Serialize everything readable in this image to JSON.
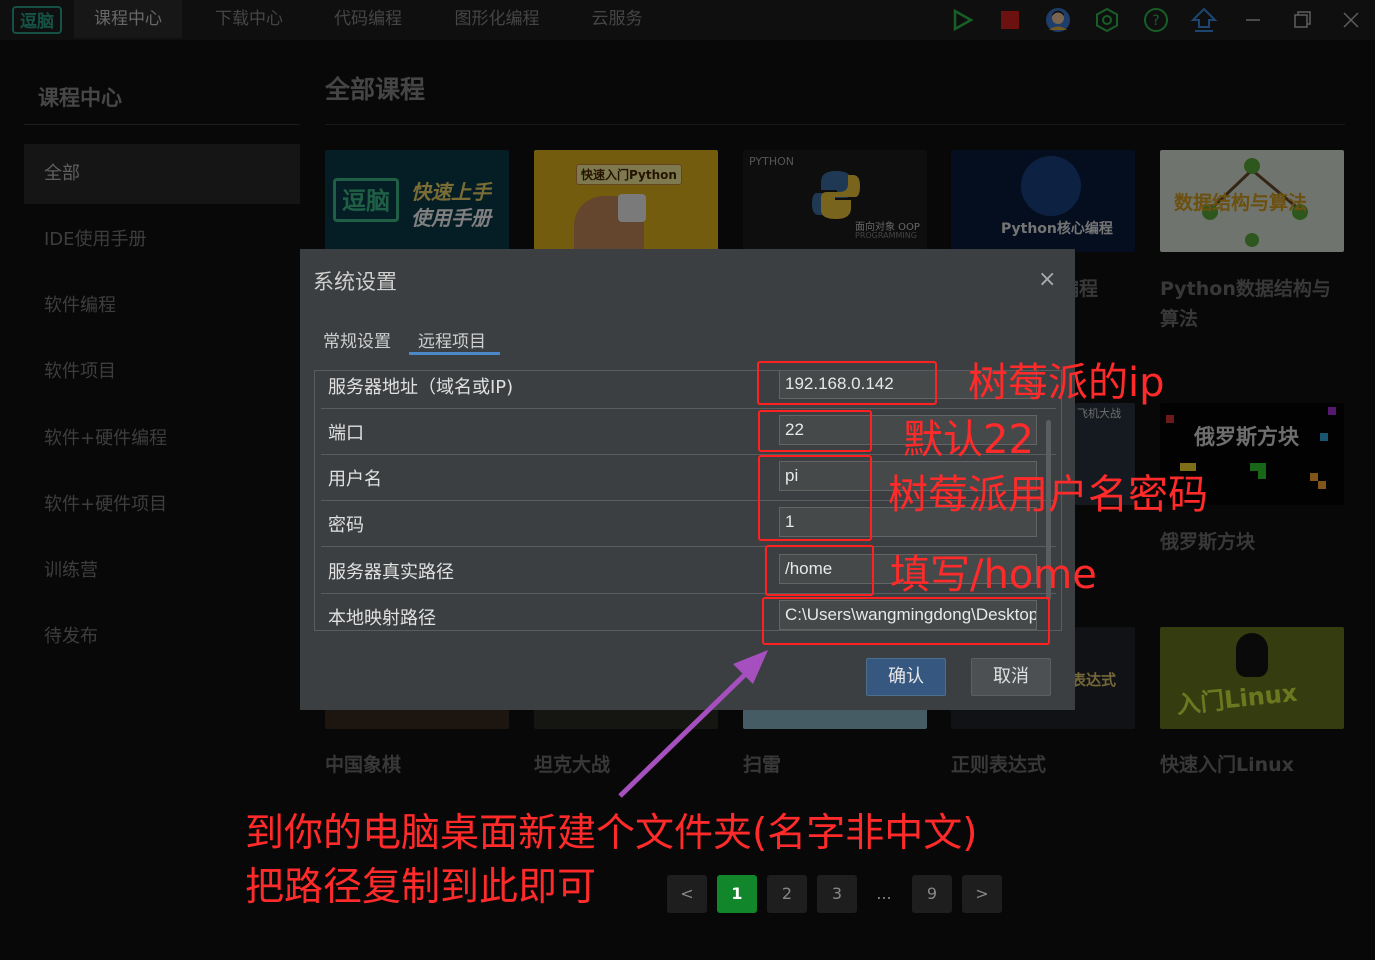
{
  "app": {
    "logo_text": "逗脑"
  },
  "nav": {
    "tabs": [
      "课程中心",
      "下载中心",
      "代码编程",
      "图形化编程",
      "云服务"
    ],
    "active_index": 0
  },
  "toolbar_icons": [
    "run-icon",
    "stop-icon",
    "user-avatar-icon",
    "settings-hex-icon",
    "help-icon",
    "upload-icon",
    "minimize-icon",
    "restore-icon",
    "close-icon"
  ],
  "sidebar": {
    "title": "课程中心",
    "items": [
      "全部",
      "IDE使用手册",
      "软件编程",
      "软件项目",
      "软件+硬件编程",
      "软件+硬件项目",
      "训练营",
      "待发布"
    ],
    "active_index": 0
  },
  "main": {
    "title": "全部课程",
    "cards_row1": [
      {
        "thumb_text": [
          "逗脑",
          "快速上手",
          "使用手册"
        ],
        "title": ""
      },
      {
        "thumb_text": [
          "快速入门Python"
        ],
        "title": ""
      },
      {
        "thumb_text": [
          "PYTHON",
          "面向对象 OOP",
          "PROGRAMMING"
        ],
        "title": ""
      },
      {
        "thumb_text": [
          "Python核心编程"
        ],
        "title": "编程"
      },
      {
        "thumb_text": [
          "数据结构与算法"
        ],
        "title": "Python数据结构与算法"
      }
    ],
    "cards_row2": [
      {
        "thumb_text": [
          "飞机大战"
        ],
        "title": ""
      },
      {
        "thumb_text": [
          "俄罗斯方块"
        ],
        "title": "俄罗斯方块"
      }
    ],
    "cards_row3": [
      {
        "thumb_text": [],
        "title": "中国象棋"
      },
      {
        "thumb_text": [],
        "title": "坦克大战"
      },
      {
        "thumb_text": [],
        "title": "扫雷"
      },
      {
        "thumb_text": [
          "表达式"
        ],
        "title": "正则表达式"
      },
      {
        "thumb_text": [
          "入门Linux"
        ],
        "title": "快速入门Linux"
      }
    ]
  },
  "pagination": {
    "prev": "<",
    "pages": [
      "1",
      "2",
      "3",
      "...",
      "9"
    ],
    "next": ">",
    "active": "1"
  },
  "dialog": {
    "title": "系统设置",
    "close": "×",
    "tabs": [
      "常规设置",
      "远程项目"
    ],
    "active_tab": 1,
    "fields": [
      {
        "label": "服务器地址（域名或IP)",
        "value": "192.168.0.142"
      },
      {
        "label": "端口",
        "value": "22"
      },
      {
        "label": "用户名",
        "value": "pi"
      },
      {
        "label": "密码",
        "value": "1"
      },
      {
        "label": "服务器真实路径",
        "value": "/home"
      },
      {
        "label": "本地映射路径",
        "value": "C:\\Users\\wangmingdong\\Desktop"
      }
    ],
    "ok_label": "确认",
    "cancel_label": "取消"
  },
  "annotations": {
    "ip_note": "树莓派的ip",
    "port_note": "默认22",
    "cred_note": "树莓派用户名密码",
    "path_note": "填写/home",
    "folder_note_line1": "到你的电脑桌面新建个文件夹(名字非中文)",
    "folder_note_line2": "把路径复制到此即可",
    "color": "#ff2a2a",
    "arrow_color": "#a64fbf"
  }
}
